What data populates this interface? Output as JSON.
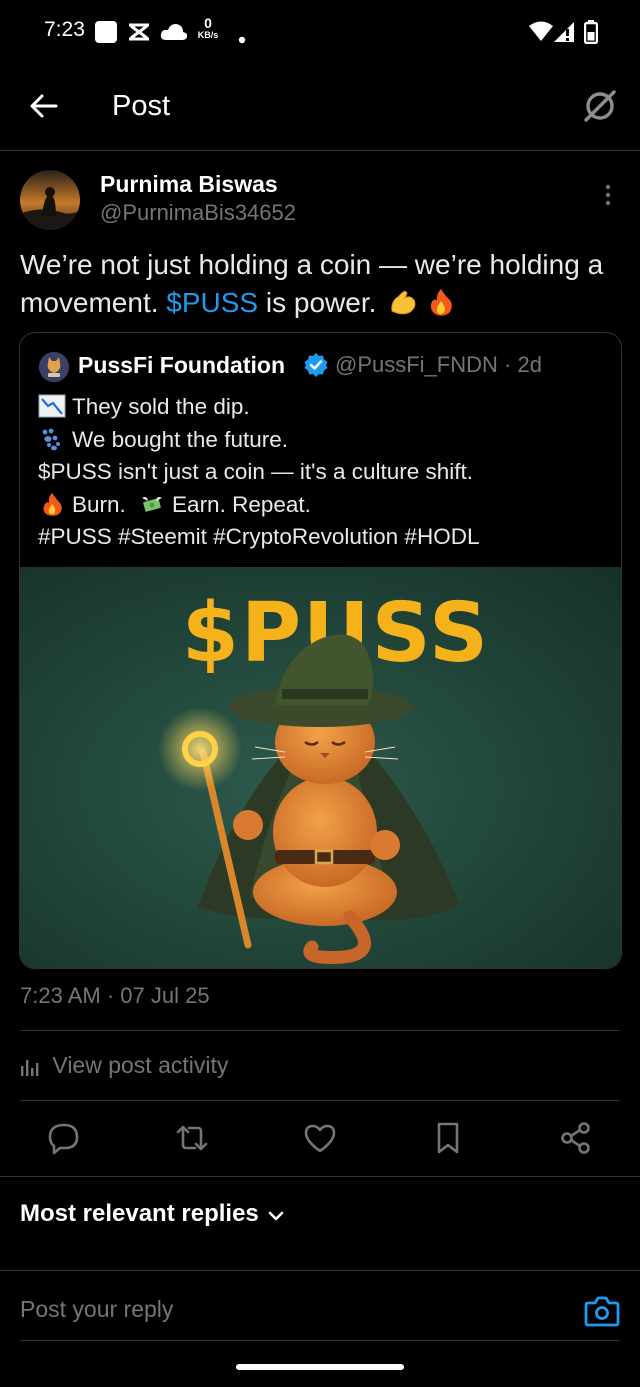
{
  "status_bar": {
    "time": "7:23",
    "net_speed_value": "0",
    "net_speed_unit": "KB/s"
  },
  "header": {
    "title": "Post"
  },
  "post": {
    "author_name": "Purnima Biswas",
    "author_handle": "@PurnimaBis34652",
    "text_before": "We’re not just holding a coin — we’re holding a movement.",
    "cashtag": "$PUSS",
    "text_after": "is power.",
    "emojis": [
      "flexed-biceps",
      "fire"
    ],
    "timestamp": "7:23 AM · 07 Jul 25"
  },
  "quoted_post": {
    "author_name": "PussFi Foundation",
    "author_handle": "@PussFi_FNDN",
    "age": "· 2d",
    "verified": true,
    "lines": [
      {
        "icon": "chart-decreasing-emoji",
        "text": "They sold the dip."
      },
      {
        "icon": "paw-prints-emoji",
        "text": "We bought the future."
      },
      {
        "icon": "",
        "text": "$PUSS isn't just a coin — it's a culture shift."
      },
      {
        "icon": "fire-emoji",
        "text": "Burn."
      },
      {
        "icon": "money-with-wings-emoji",
        "text": "Earn. Repeat."
      },
      {
        "icon": "",
        "text": "#PUSS #Steemit #CryptoRevolution #HODL"
      }
    ],
    "media_headline": "$PUSS"
  },
  "view_activity": "View post activity",
  "actions": [
    "reply-icon",
    "repost-icon",
    "like-icon",
    "bookmark-icon",
    "share-icon"
  ],
  "replies_sort": "Most relevant replies",
  "reply_input": {
    "placeholder": "Post your reply"
  },
  "colors": {
    "accent": "#1d9bf0",
    "muted": "#71767b",
    "background": "#000000",
    "divider": "#2f3336",
    "media_bg": "#1f4038",
    "media_gold": "#f5b21b"
  }
}
